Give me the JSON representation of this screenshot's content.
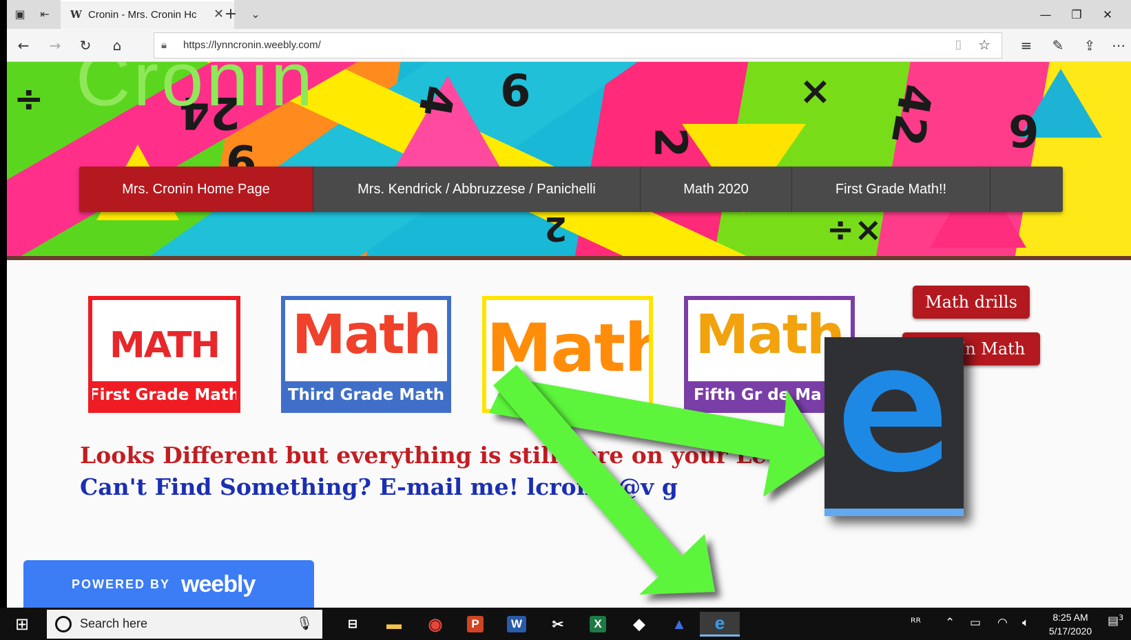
{
  "browser": {
    "tab_title": "Cronin - Mrs. Cronin Hc",
    "url": "https://lynncronin.weebly.com/"
  },
  "site": {
    "title": "Cronin",
    "menu": [
      {
        "label": "Mrs. Cronin Home Page",
        "active": true
      },
      {
        "label": "Mrs. Kendrick / Abbruzzese / Panichelli",
        "active": false
      },
      {
        "label": "Math 2020",
        "active": false
      },
      {
        "label": "First Grade Math!!",
        "active": false
      }
    ],
    "cards": [
      {
        "word": "MATH",
        "caption": "First Grade Math",
        "border": "#ef1c24"
      },
      {
        "word": "Math",
        "caption": "Third Grade Math",
        "border": "#3f6fc9"
      },
      {
        "word": "Math",
        "caption": "",
        "border": "#ffe400"
      },
      {
        "word": "Math",
        "caption": "Fifth Gr de Ma",
        "border": "#7a3ea7"
      }
    ],
    "side_buttons": [
      "Math drills",
      "In Math"
    ],
    "message_line1": "Looks Different but everything is still here    on your       Lev",
    "message_line2": "Can't Find Something?  E-mail me!  lcronin@v          g",
    "powered_by": "POWERED BY",
    "brand": "weebly"
  },
  "taskbar": {
    "search_placeholder": "Search here",
    "time": "8:25 AM",
    "date": "5/17/2020",
    "notification_count": "3"
  },
  "colors": {
    "menu_active": "#b3191f",
    "arrow": "#5cf53a",
    "edge_blue": "#1e88e5"
  }
}
